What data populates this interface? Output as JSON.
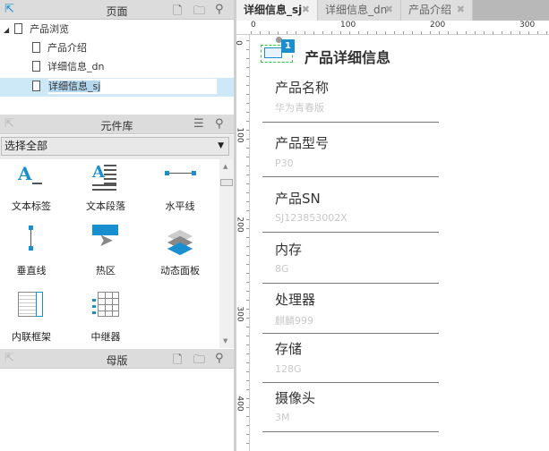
{
  "pages_panel": {
    "title": "页面",
    "items": [
      {
        "label": "产品浏览"
      },
      {
        "label": "产品介绍"
      },
      {
        "label": "详细信息_dn"
      },
      {
        "label": "详细信息_sj"
      }
    ]
  },
  "library_panel": {
    "title": "元件库",
    "dropdown": "选择全部",
    "widgets": [
      {
        "label": "文本标签"
      },
      {
        "label": "文本段落"
      },
      {
        "label": "水平线"
      },
      {
        "label": "垂直线"
      },
      {
        "label": "热区"
      },
      {
        "label": "动态面板"
      },
      {
        "label": "内联框架"
      },
      {
        "label": "中继器"
      }
    ]
  },
  "masters_panel": {
    "title": "母版"
  },
  "tabs": [
    {
      "label": "详细信息_sj",
      "active": true
    },
    {
      "label": "详细信息_dn"
    },
    {
      "label": "产品介绍"
    }
  ],
  "ruler": {
    "h": [
      "0",
      "100",
      "200",
      "300"
    ],
    "v": [
      "0",
      "100",
      "200",
      "300",
      "400"
    ]
  },
  "canvas": {
    "badge": "1",
    "title": "产品详细信息",
    "fields": [
      {
        "label": "产品名称",
        "value": "华为青春版"
      },
      {
        "label": "产品型号",
        "value": "P30"
      },
      {
        "label": "产品SN",
        "value": "SJ123853002X"
      },
      {
        "label": "内存",
        "value": "8G"
      },
      {
        "label": "处理器",
        "value": "麒麟999"
      },
      {
        "label": "存储",
        "value": "128G"
      },
      {
        "label": "摄像头",
        "value": "3M"
      }
    ]
  },
  "colors": {
    "accent": "#1a8fd0",
    "selection": "#cde8f7"
  }
}
